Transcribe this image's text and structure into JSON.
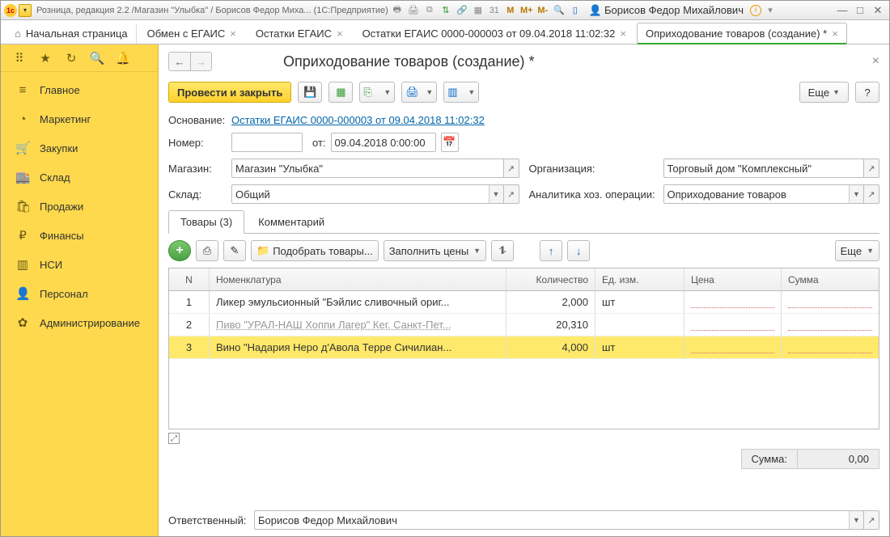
{
  "titlebar": {
    "title": "Розница, редакция 2.2 /Магазин \"Улыбка\" / Борисов Федор Миха... (1С:Предприятие)",
    "user": "Борисов Федор Михайлович"
  },
  "tabs": [
    {
      "label": "Начальная страница",
      "home": true
    },
    {
      "label": "Обмен с ЕГАИС"
    },
    {
      "label": "Остатки ЕГАИС"
    },
    {
      "label": "Остатки ЕГАИС 0000-000003 от 09.04.2018 11:02:32"
    },
    {
      "label": "Оприходование товаров (создание) *",
      "active": true
    }
  ],
  "nav": [
    {
      "icon": "≡",
      "label": "Главное"
    },
    {
      "icon": "◔",
      "label": "Маркетинг"
    },
    {
      "icon": "🛒",
      "label": "Закупки"
    },
    {
      "icon": "🏬",
      "label": "Склад"
    },
    {
      "icon": "🛍",
      "label": "Продажи"
    },
    {
      "icon": "₽",
      "label": "Финансы"
    },
    {
      "icon": "▥",
      "label": "НСИ"
    },
    {
      "icon": "👤",
      "label": "Персонал"
    },
    {
      "icon": "✿",
      "label": "Администрирование"
    }
  ],
  "page": {
    "title": "Оприходование товаров (создание) *",
    "post_close": "Провести и закрыть",
    "more": "Еще",
    "basis_lbl": "Основание:",
    "basis_link": "Остатки ЕГАИС 0000-000003 от 09.04.2018 11:02:32",
    "number_lbl": "Номер:",
    "from_lbl": "от:",
    "date": "09.04.2018  0:00:00",
    "store_lbl": "Магазин:",
    "store": "Магазин \"Улыбка\"",
    "org_lbl": "Организация:",
    "org": "Торговый дом \"Комплексный\"",
    "wh_lbl": "Склад:",
    "wh": "Общий",
    "anal_lbl": "Аналитика хоз. операции:",
    "anal": "Оприходование товаров",
    "tab_goods": "Товары (3)",
    "tab_comment": "Комментарий",
    "pick": "Подобрать товары...",
    "fill_prices": "Заполнить цены",
    "gh": {
      "n": "N",
      "nom": "Номенклатура",
      "qty": "Количество",
      "um": "Ед. изм.",
      "price": "Цена",
      "sum": "Сумма"
    },
    "rows": [
      {
        "n": "1",
        "nom": "Ликер эмульсионный \"Бэйлис сливочный ориг...",
        "qty": "2,000",
        "um": "шт"
      },
      {
        "n": "2",
        "nom": "Пиво \"УРАЛ-НАШ Хоппи Лагер\" Кег. Санкт-Пет...",
        "qty": "20,310",
        "um": ""
      },
      {
        "n": "3",
        "nom": "Вино \"Надария Неро д'Авола Терре Сичилиан...",
        "qty": "4,000",
        "um": "шт"
      }
    ],
    "total_lbl": "Сумма:",
    "total_val": "0,00",
    "resp_lbl": "Ответственный:",
    "resp": "Борисов Федор Михайлович"
  }
}
